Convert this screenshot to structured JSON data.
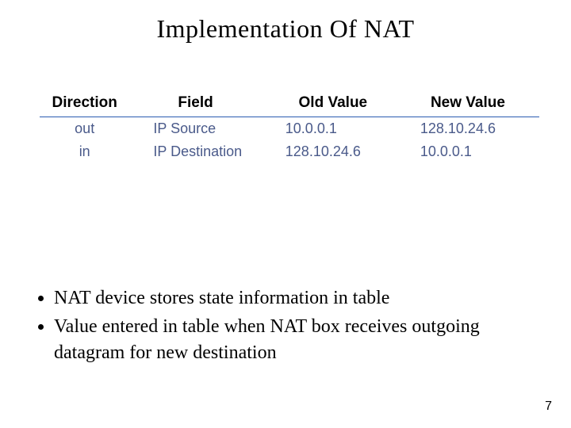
{
  "title": "Implementation Of NAT",
  "table": {
    "headers": [
      "Direction",
      "Field",
      "Old Value",
      "New Value"
    ],
    "rows": [
      {
        "direction": "out",
        "field": "IP Source",
        "old": "10.0.0.1",
        "new": "128.10.24.6"
      },
      {
        "direction": "in",
        "field": "IP Destination",
        "old": "128.10.24.6",
        "new": "10.0.0.1"
      }
    ]
  },
  "bullets": [
    "NAT device stores state information in table",
    "Value entered in table when NAT box receives outgoing datagram for new destination"
  ],
  "page_number": "7"
}
